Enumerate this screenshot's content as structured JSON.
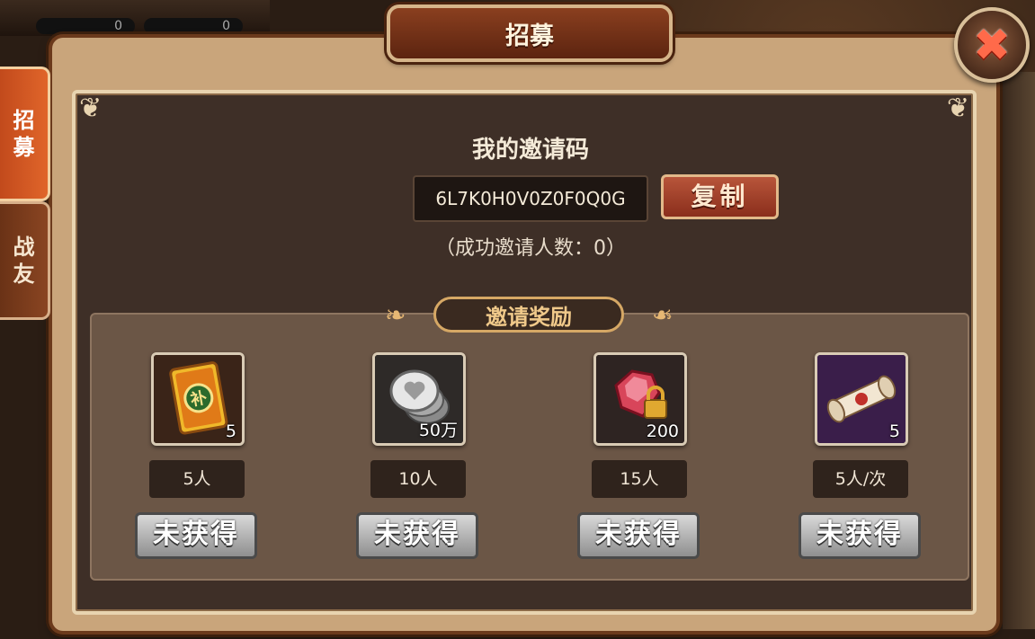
{
  "background": {
    "top_counters": [
      "0",
      "0"
    ]
  },
  "title": "招募",
  "close_icon": "close-x-icon",
  "side_tabs": [
    {
      "label_line1": "招",
      "label_line2": "募",
      "active": true
    },
    {
      "label_line1": "战",
      "label_line2": "友",
      "active": false
    }
  ],
  "invite": {
    "title": "我的邀请码",
    "code": "6L7K0H0V0Z0F0Q0G",
    "copy_label": "复制",
    "success_text": "（成功邀请人数：0）"
  },
  "rewards": {
    "header": "邀请奖励",
    "items": [
      {
        "icon": "supplement-card-icon",
        "quantity": "5",
        "requirement": "5人",
        "status": "未获得"
      },
      {
        "icon": "silver-coin-icon",
        "quantity": "50万",
        "requirement": "10人",
        "status": "未获得"
      },
      {
        "icon": "locked-gem-icon",
        "quantity": "200",
        "requirement": "15人",
        "status": "未获得"
      },
      {
        "icon": "scroll-icon",
        "quantity": "5",
        "requirement": "5人/次",
        "status": "未获得"
      }
    ]
  },
  "colors": {
    "accent_red": "#c24a1c",
    "frame_tan": "#c9a57b",
    "panel_dark": "#3e2f27"
  }
}
